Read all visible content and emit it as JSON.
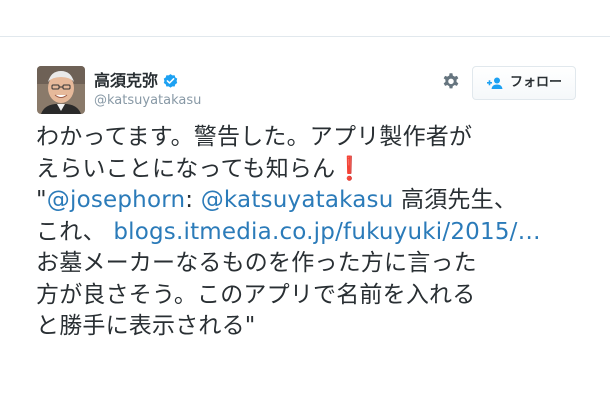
{
  "profile": {
    "display_name": "高須克弥",
    "screen_name": "@katsuyatakasu",
    "verified": true
  },
  "actions": {
    "follow_label": "フォロー",
    "settings_icon": "gear-icon",
    "follow_icon": "follow-person-plus-icon"
  },
  "tweet": {
    "line1": "わかってます。警告した。アプリ製作者が",
    "line2_text": "えらいことになっても知らん",
    "line2_emoji": "❗",
    "line3_open": "\"",
    "line3_mention1": "@josephorn",
    "line3_colon": ": ",
    "line3_mention2": "@katsuyatakasu",
    "line3_rest": " 高須先生、",
    "line4_text": "これ、 ",
    "line4_link": "blogs.itmedia.co.jp/fukuyuki/2015/…",
    "line5": "お墓メーカーなるものを作った方に言った",
    "line6": "方が良さそう。このアプリで名前を入れる",
    "line7": "と勝手に表示される\""
  },
  "colors": {
    "link": "#2b7bb9",
    "text": "#292f33",
    "muted": "#8899a6",
    "verified": "#1da1f2",
    "emoji": "#dd2e44"
  }
}
